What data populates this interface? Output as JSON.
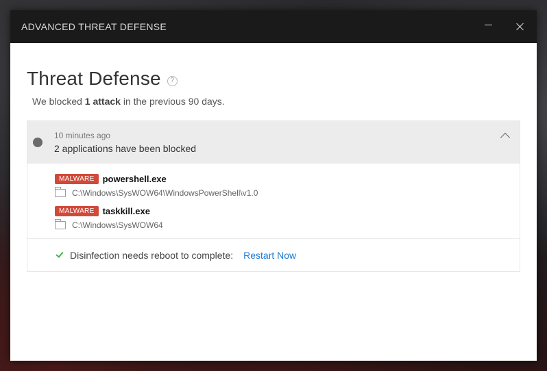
{
  "window": {
    "title": "ADVANCED THREAT DEFENSE"
  },
  "header": {
    "title": "Threat Defense",
    "help_icon": "?",
    "summary_prefix": "We blocked ",
    "summary_bold": "1 attack",
    "summary_suffix": " in the previous 90 days."
  },
  "event": {
    "time": "10 minutes ago",
    "description": "2 applications have been blocked",
    "apps": [
      {
        "badge": "MALWARE",
        "name": "powershell.exe",
        "path": "C:\\Windows\\SysWOW64\\WindowsPowerShell\\v1.0"
      },
      {
        "badge": "MALWARE",
        "name": "taskkill.exe",
        "path": "C:\\Windows\\SysWOW64"
      }
    ],
    "status_text": "Disinfection needs reboot to complete:",
    "action_link": "Restart Now"
  },
  "colors": {
    "badge": "#d04a3a",
    "link": "#1a7ad6",
    "check": "#44b040",
    "titlebar": "#1a1a1a"
  }
}
